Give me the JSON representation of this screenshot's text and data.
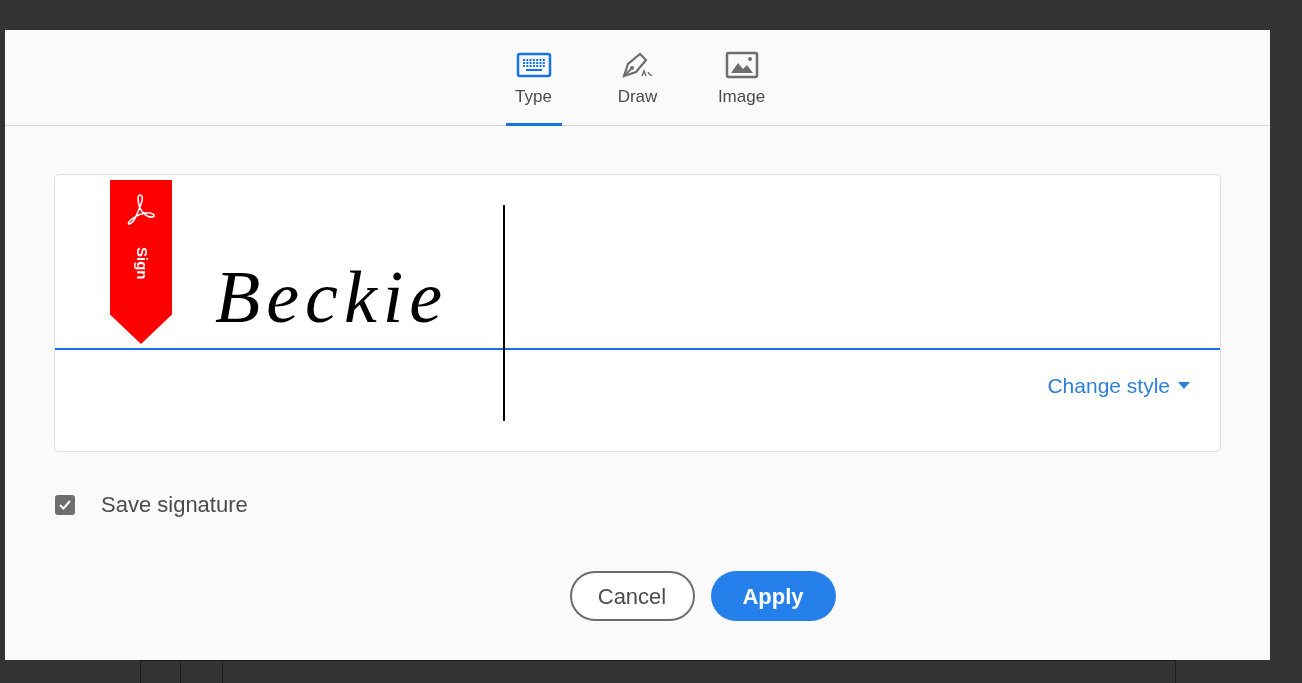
{
  "tabs": [
    {
      "label": "Type",
      "kind": "keyboard",
      "selected": true
    },
    {
      "label": "Draw",
      "kind": "pen",
      "selected": false
    },
    {
      "label": "Image",
      "kind": "image",
      "selected": false
    }
  ],
  "signature": {
    "value": "Beckie",
    "ribbon_label": "Sign"
  },
  "change_style": "Change style",
  "save_signature": {
    "label": "Save signature",
    "checked": true
  },
  "buttons": [
    {
      "label": "Cancel",
      "kind": "secondary"
    },
    {
      "label": "Apply",
      "kind": "primary"
    }
  ]
}
